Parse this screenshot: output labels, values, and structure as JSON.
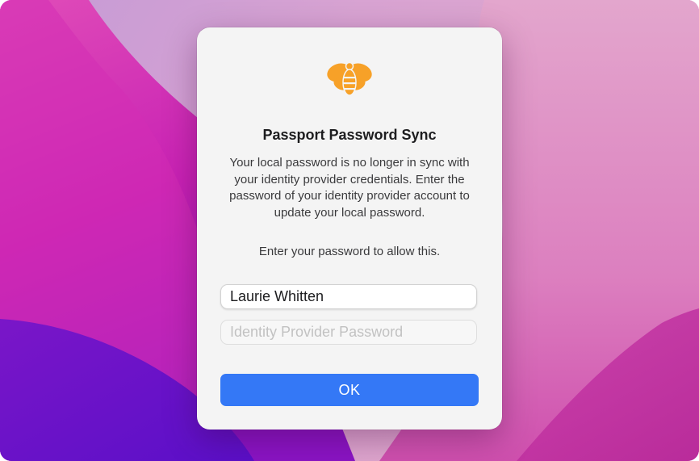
{
  "dialog": {
    "title": "Passport Password Sync",
    "message": "Your local password is no longer in sync with your identity provider credentials. Enter the password of your identity provider account to update your local password.",
    "prompt": "Enter your password to allow this.",
    "username": {
      "value": "Laurie Whitten"
    },
    "password": {
      "value": "",
      "placeholder": "Identity Provider Password"
    },
    "ok_label": "OK"
  },
  "icons": {
    "app": "bee-icon"
  },
  "colors": {
    "accent": "#3478f6",
    "bee": "#f7a128",
    "dialog_bg": "#f4f4f4",
    "wallpaper_purple": "#6a12c9",
    "wallpaper_magenta": "#d12fb0",
    "wallpaper_pink": "#de98c8"
  }
}
